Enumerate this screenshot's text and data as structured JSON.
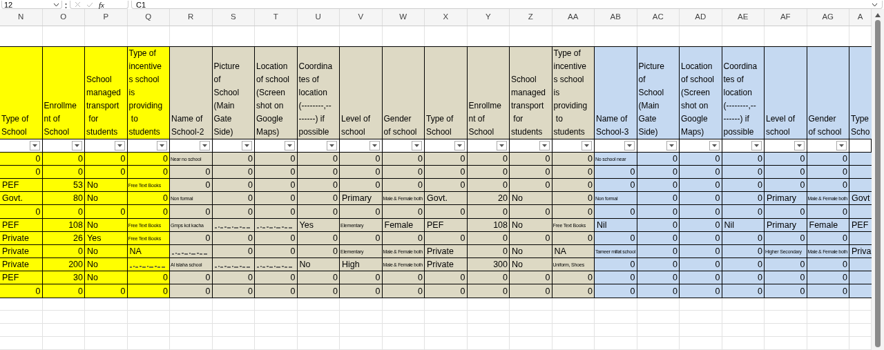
{
  "formula_bar": {
    "name_box": "12",
    "function_label": "fx",
    "formula": "C1"
  },
  "column_letters": [
    "N",
    "O",
    "P",
    "Q",
    "R",
    "S",
    "T",
    "U",
    "V",
    "W",
    "X",
    "Y",
    "Z",
    "AA",
    "AB",
    "AC",
    "AD",
    "AE",
    "AF",
    "AG",
    "A"
  ],
  "columns": [
    {
      "header": "Type of\nSchool",
      "color": "#ffff00"
    },
    {
      "header": "Enrollme\nnt of\nSchool",
      "color": "#ffff00"
    },
    {
      "header": "School\nmanaged\ntransport\n for\nstudents",
      "color": "#ffff00"
    },
    {
      "header": "Type of\nincentive\ns school\nis\nproviding\n to\nstudents",
      "color": "#ffff00"
    },
    {
      "header": "Name of\nSchool-2",
      "color": "#ddd9c4"
    },
    {
      "header": "Picture\nof\nSchool\n(Main\nGate\nSide)",
      "color": "#ddd9c4"
    },
    {
      "header": "Location\nof school\n(Screen\nshot on\nGoogle\nMaps)",
      "color": "#ddd9c4"
    },
    {
      "header": "Coordina\ntes of\nlocation\n(--------,--\n------) if\npossible",
      "color": "#ddd9c4"
    },
    {
      "header": "Level of\nschool",
      "color": "#ddd9c4"
    },
    {
      "header": "Gender\nof school",
      "color": "#ddd9c4"
    },
    {
      "header": "Type of\nSchool",
      "color": "#ddd9c4"
    },
    {
      "header": "Enrollme\nnt of\nSchool",
      "color": "#ddd9c4"
    },
    {
      "header": "School\nmanaged\ntransport\n for\nstudents",
      "color": "#ddd9c4"
    },
    {
      "header": "Type of\nincentive\ns school\nis\nproviding\n to\nstudents",
      "color": "#ddd9c4"
    },
    {
      "header": "Name of\nSchool-3",
      "color": "#c5d9f1"
    },
    {
      "header": "Picture\nof\nSchool\n(Main\nGate\nSide)",
      "color": "#c5d9f1"
    },
    {
      "header": "Location\nof school\n(Screen\nshot on\nGoogle\nMaps)",
      "color": "#c5d9f1"
    },
    {
      "header": "Coordina\ntes of\nlocation\n(--------,--\n------) if\npossible",
      "color": "#c5d9f1"
    },
    {
      "header": "Level of\nschool",
      "color": "#c5d9f1"
    },
    {
      "header": "Gender\nof school",
      "color": "#c5d9f1"
    },
    {
      "header": "Type\nScho",
      "color": "#c5d9f1"
    }
  ],
  "rows": [
    [
      {
        "kind": "num",
        "text": "0"
      },
      {
        "kind": "num",
        "text": "0"
      },
      {
        "kind": "num",
        "text": "0"
      },
      {
        "kind": "num",
        "text": "0"
      },
      {
        "kind": "small",
        "text": "Near no school"
      },
      {
        "kind": "num",
        "text": "0"
      },
      {
        "kind": "num",
        "text": "0"
      },
      {
        "kind": "num",
        "text": "0"
      },
      {
        "kind": "num",
        "text": "0"
      },
      {
        "kind": "num",
        "text": "0"
      },
      {
        "kind": "num",
        "text": "0"
      },
      {
        "kind": "num",
        "text": "0"
      },
      {
        "kind": "num",
        "text": "0"
      },
      {
        "kind": "num",
        "text": "0"
      },
      {
        "kind": "small",
        "text": "No school near"
      },
      {
        "kind": "num",
        "text": "0"
      },
      {
        "kind": "num",
        "text": "0"
      },
      {
        "kind": "num",
        "text": "0"
      },
      {
        "kind": "num",
        "text": "0"
      },
      {
        "kind": "num",
        "text": "0"
      },
      {
        "kind": "empty"
      }
    ],
    [
      {
        "kind": "num",
        "text": "0"
      },
      {
        "kind": "num",
        "text": "0"
      },
      {
        "kind": "num",
        "text": "0"
      },
      {
        "kind": "num",
        "text": "0"
      },
      {
        "kind": "num",
        "text": "0"
      },
      {
        "kind": "num",
        "text": "0"
      },
      {
        "kind": "num",
        "text": "0"
      },
      {
        "kind": "num",
        "text": "0"
      },
      {
        "kind": "num",
        "text": "0"
      },
      {
        "kind": "num",
        "text": "0"
      },
      {
        "kind": "num",
        "text": "0"
      },
      {
        "kind": "num",
        "text": "0"
      },
      {
        "kind": "num",
        "text": "0"
      },
      {
        "kind": "num",
        "text": "0"
      },
      {
        "kind": "num",
        "text": "0"
      },
      {
        "kind": "num",
        "text": "0"
      },
      {
        "kind": "num",
        "text": "0"
      },
      {
        "kind": "num",
        "text": "0"
      },
      {
        "kind": "num",
        "text": "0"
      },
      {
        "kind": "num",
        "text": "0"
      },
      {
        "kind": "empty"
      }
    ],
    [
      {
        "kind": "text",
        "text": "PEF"
      },
      {
        "kind": "num",
        "text": "53"
      },
      {
        "kind": "text",
        "text": "No"
      },
      {
        "kind": "small",
        "text": "Free Text Books"
      },
      {
        "kind": "num",
        "text": "0"
      },
      {
        "kind": "num",
        "text": "0"
      },
      {
        "kind": "num",
        "text": "0"
      },
      {
        "kind": "num",
        "text": "0"
      },
      {
        "kind": "num",
        "text": "0"
      },
      {
        "kind": "num",
        "text": "0"
      },
      {
        "kind": "num",
        "text": "0"
      },
      {
        "kind": "num",
        "text": "0"
      },
      {
        "kind": "num",
        "text": "0"
      },
      {
        "kind": "num",
        "text": "0"
      },
      {
        "kind": "num",
        "text": "0"
      },
      {
        "kind": "num",
        "text": "0"
      },
      {
        "kind": "num",
        "text": "0"
      },
      {
        "kind": "num",
        "text": "0"
      },
      {
        "kind": "num",
        "text": "0"
      },
      {
        "kind": "num",
        "text": "0"
      },
      {
        "kind": "empty"
      }
    ],
    [
      {
        "kind": "text",
        "text": "Govt."
      },
      {
        "kind": "num",
        "text": "80"
      },
      {
        "kind": "text",
        "text": "No"
      },
      {
        "kind": "num",
        "text": "0"
      },
      {
        "kind": "small",
        "text": "Non formal"
      },
      {
        "kind": "num",
        "text": "0"
      },
      {
        "kind": "num",
        "text": "0"
      },
      {
        "kind": "num",
        "text": "0"
      },
      {
        "kind": "text",
        "text": "Primary"
      },
      {
        "kind": "tiny",
        "text": "Male & Female both"
      },
      {
        "kind": "text",
        "text": "Govt."
      },
      {
        "kind": "num",
        "text": "20"
      },
      {
        "kind": "text",
        "text": "No"
      },
      {
        "kind": "num",
        "text": "0"
      },
      {
        "kind": "small",
        "text": "Non formal"
      },
      {
        "kind": "num",
        "text": "0"
      },
      {
        "kind": "num",
        "text": "0"
      },
      {
        "kind": "num",
        "text": "0"
      },
      {
        "kind": "text",
        "text": "Primary"
      },
      {
        "kind": "tiny",
        "text": "Male & Female both"
      },
      {
        "kind": "text",
        "text": "Govt"
      }
    ],
    [
      {
        "kind": "num",
        "text": "0"
      },
      {
        "kind": "num",
        "text": "0"
      },
      {
        "kind": "num",
        "text": "0"
      },
      {
        "kind": "num",
        "text": "0"
      },
      {
        "kind": "num",
        "text": "0"
      },
      {
        "kind": "num",
        "text": "0"
      },
      {
        "kind": "num",
        "text": "0"
      },
      {
        "kind": "num",
        "text": "0"
      },
      {
        "kind": "num",
        "text": "0"
      },
      {
        "kind": "num",
        "text": "0"
      },
      {
        "kind": "num",
        "text": "0"
      },
      {
        "kind": "num",
        "text": "0"
      },
      {
        "kind": "num",
        "text": "0"
      },
      {
        "kind": "num",
        "text": "0"
      },
      {
        "kind": "num",
        "text": "0"
      },
      {
        "kind": "num",
        "text": "0"
      },
      {
        "kind": "num",
        "text": "0"
      },
      {
        "kind": "num",
        "text": "0"
      },
      {
        "kind": "num",
        "text": "0"
      },
      {
        "kind": "num",
        "text": "0"
      },
      {
        "kind": "empty"
      }
    ],
    [
      {
        "kind": "text",
        "text": "PEF"
      },
      {
        "kind": "num",
        "text": "108"
      },
      {
        "kind": "text",
        "text": "No"
      },
      {
        "kind": "small",
        "text": "Free Text Books"
      },
      {
        "kind": "small",
        "text": "Gmps kot kacha"
      },
      {
        "kind": "scribble"
      },
      {
        "kind": "scribble"
      },
      {
        "kind": "text",
        "text": "Yes"
      },
      {
        "kind": "small",
        "text": "Elementary"
      },
      {
        "kind": "text",
        "text": "Female"
      },
      {
        "kind": "text",
        "text": "PEF"
      },
      {
        "kind": "num",
        "text": "108"
      },
      {
        "kind": "text",
        "text": "No"
      },
      {
        "kind": "small",
        "text": "Free Text Books"
      },
      {
        "kind": "text",
        "text": "Nil"
      },
      {
        "kind": "num",
        "text": "0"
      },
      {
        "kind": "num",
        "text": "0"
      },
      {
        "kind": "text",
        "text": "Nil"
      },
      {
        "kind": "text",
        "text": "Primary"
      },
      {
        "kind": "text",
        "text": "Female"
      },
      {
        "kind": "text",
        "text": "PEF"
      }
    ],
    [
      {
        "kind": "text",
        "text": "Private"
      },
      {
        "kind": "num",
        "text": "26"
      },
      {
        "kind": "text",
        "text": "Yes"
      },
      {
        "kind": "small",
        "text": "Free Text Books"
      },
      {
        "kind": "num",
        "text": "0"
      },
      {
        "kind": "num",
        "text": "0"
      },
      {
        "kind": "num",
        "text": "0"
      },
      {
        "kind": "num",
        "text": "0"
      },
      {
        "kind": "num",
        "text": "0"
      },
      {
        "kind": "num",
        "text": "0"
      },
      {
        "kind": "num",
        "text": "0"
      },
      {
        "kind": "num",
        "text": "0"
      },
      {
        "kind": "num",
        "text": "0"
      },
      {
        "kind": "num",
        "text": "0"
      },
      {
        "kind": "num",
        "text": "0"
      },
      {
        "kind": "num",
        "text": "0"
      },
      {
        "kind": "num",
        "text": "0"
      },
      {
        "kind": "num",
        "text": "0"
      },
      {
        "kind": "num",
        "text": "0"
      },
      {
        "kind": "num",
        "text": "0"
      },
      {
        "kind": "empty"
      }
    ],
    [
      {
        "kind": "text",
        "text": "Private"
      },
      {
        "kind": "num",
        "text": "0"
      },
      {
        "kind": "text",
        "text": "No"
      },
      {
        "kind": "text",
        "text": "NA"
      },
      {
        "kind": "scribble"
      },
      {
        "kind": "num",
        "text": "0"
      },
      {
        "kind": "num",
        "text": "0"
      },
      {
        "kind": "num",
        "text": "0"
      },
      {
        "kind": "small",
        "text": "Elementary"
      },
      {
        "kind": "tiny",
        "text": "Male & Female both"
      },
      {
        "kind": "text",
        "text": "Private"
      },
      {
        "kind": "num",
        "text": "0"
      },
      {
        "kind": "text",
        "text": "No"
      },
      {
        "kind": "text",
        "text": "NA"
      },
      {
        "kind": "tiny",
        "text": "Tameer millat school"
      },
      {
        "kind": "num",
        "text": "0"
      },
      {
        "kind": "num",
        "text": "0"
      },
      {
        "kind": "num",
        "text": "0"
      },
      {
        "kind": "small",
        "text": "Higher Secondary"
      },
      {
        "kind": "tiny",
        "text": "Male & Female both"
      },
      {
        "kind": "text",
        "text": "Priva"
      }
    ],
    [
      {
        "kind": "text",
        "text": "Private"
      },
      {
        "kind": "num",
        "text": "200"
      },
      {
        "kind": "text",
        "text": "No"
      },
      {
        "kind": "scribble"
      },
      {
        "kind": "small",
        "text": "Al islaha school"
      },
      {
        "kind": "scribble"
      },
      {
        "kind": "scribble"
      },
      {
        "kind": "text",
        "text": "No"
      },
      {
        "kind": "text",
        "text": "High"
      },
      {
        "kind": "tiny",
        "text": "Male & Female both"
      },
      {
        "kind": "text",
        "text": "Private"
      },
      {
        "kind": "num",
        "text": "300"
      },
      {
        "kind": "text",
        "text": "No"
      },
      {
        "kind": "small",
        "text": "Uniform, Shoes"
      },
      {
        "kind": "num",
        "text": "0"
      },
      {
        "kind": "num",
        "text": "0"
      },
      {
        "kind": "num",
        "text": "0"
      },
      {
        "kind": "num",
        "text": "0"
      },
      {
        "kind": "num",
        "text": "0"
      },
      {
        "kind": "num",
        "text": "0"
      },
      {
        "kind": "empty"
      }
    ],
    [
      {
        "kind": "text",
        "text": "PEF"
      },
      {
        "kind": "num",
        "text": "30"
      },
      {
        "kind": "text",
        "text": "No"
      },
      {
        "kind": "num",
        "text": "0"
      },
      {
        "kind": "num",
        "text": "0"
      },
      {
        "kind": "num",
        "text": "0"
      },
      {
        "kind": "num",
        "text": "0"
      },
      {
        "kind": "num",
        "text": "0"
      },
      {
        "kind": "num",
        "text": "0"
      },
      {
        "kind": "num",
        "text": "0"
      },
      {
        "kind": "num",
        "text": "0"
      },
      {
        "kind": "num",
        "text": "0"
      },
      {
        "kind": "num",
        "text": "0"
      },
      {
        "kind": "num",
        "text": "0"
      },
      {
        "kind": "num",
        "text": "0"
      },
      {
        "kind": "num",
        "text": "0"
      },
      {
        "kind": "num",
        "text": "0"
      },
      {
        "kind": "num",
        "text": "0"
      },
      {
        "kind": "num",
        "text": "0"
      },
      {
        "kind": "num",
        "text": "0"
      },
      {
        "kind": "empty"
      }
    ],
    [
      {
        "kind": "num",
        "text": "0"
      },
      {
        "kind": "num",
        "text": "0"
      },
      {
        "kind": "num",
        "text": "0"
      },
      {
        "kind": "num",
        "text": "0"
      },
      {
        "kind": "num",
        "text": "0"
      },
      {
        "kind": "num",
        "text": "0"
      },
      {
        "kind": "num",
        "text": "0"
      },
      {
        "kind": "num",
        "text": "0"
      },
      {
        "kind": "num",
        "text": "0"
      },
      {
        "kind": "num",
        "text": "0"
      },
      {
        "kind": "num",
        "text": "0"
      },
      {
        "kind": "num",
        "text": "0"
      },
      {
        "kind": "num",
        "text": "0"
      },
      {
        "kind": "num",
        "text": "0"
      },
      {
        "kind": "num",
        "text": "0"
      },
      {
        "kind": "num",
        "text": "0"
      },
      {
        "kind": "num",
        "text": "0"
      },
      {
        "kind": "num",
        "text": "0"
      },
      {
        "kind": "num",
        "text": "0"
      },
      {
        "kind": "num",
        "text": "0"
      },
      {
        "kind": "empty"
      }
    ]
  ]
}
